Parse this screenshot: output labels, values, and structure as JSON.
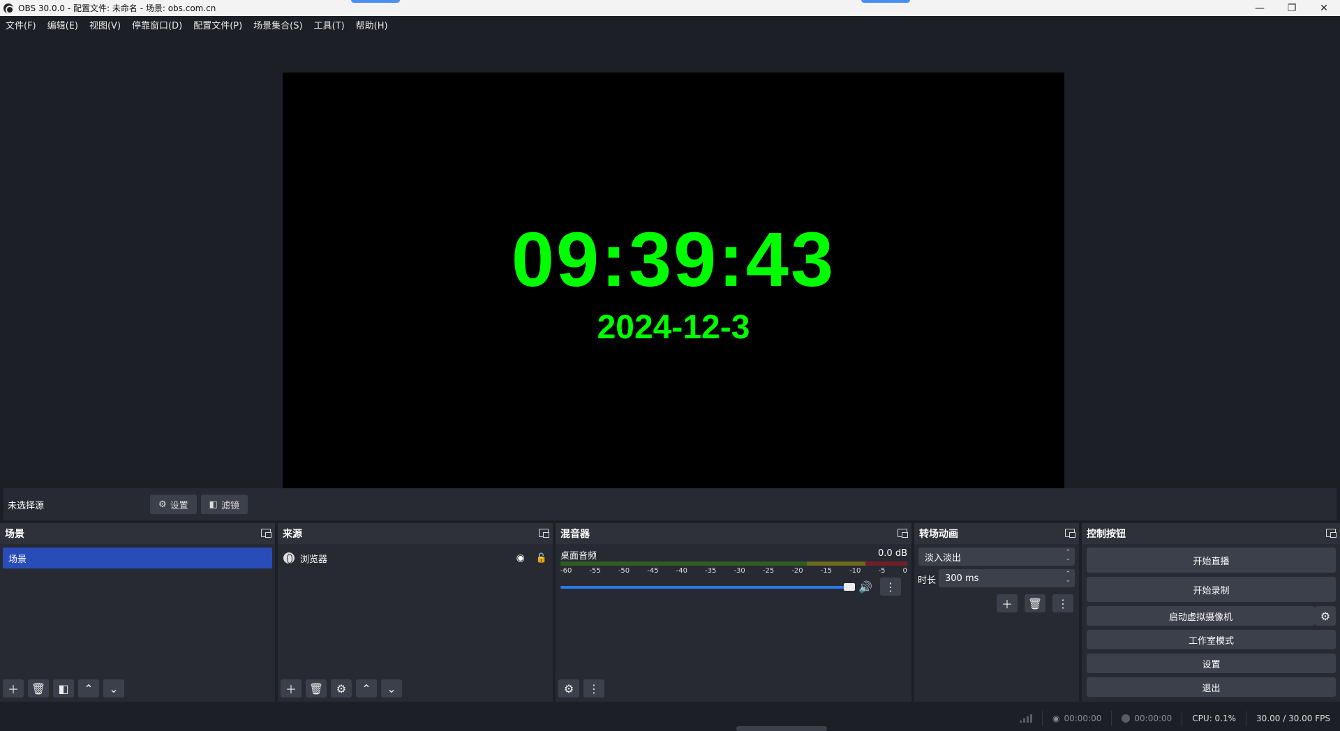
{
  "window": {
    "title": "OBS 30.0.0 - 配置文件: 未命名 - 场景: obs.com.cn",
    "controls": [
      "—",
      "❐",
      "✕"
    ]
  },
  "menu": [
    "文件(F)",
    "编辑(E)",
    "视图(V)",
    "停靠窗口(D)",
    "配置文件(P)",
    "场景集合(S)",
    "工具(T)",
    "帮助(H)"
  ],
  "preview": {
    "time": "09:39:43",
    "date": "2024-12-3",
    "text_color": "#00ff00"
  },
  "source_toolbar": {
    "no_selection": "未选择源",
    "settings": "设置",
    "filters": "滤镜"
  },
  "docks": {
    "scenes": {
      "title": "场景",
      "items": [
        "场景"
      ]
    },
    "sources": {
      "title": "来源",
      "items": [
        "浏览器"
      ]
    },
    "mixer": {
      "title": "混音器",
      "channel": "桌面音频",
      "level": "0.0 dB",
      "ticks": [
        "-60",
        "-55",
        "-50",
        "-45",
        "-40",
        "-35",
        "-30",
        "-25",
        "-20",
        "-15",
        "-10",
        "-5",
        "0"
      ],
      "volume_fraction": 1.0
    },
    "transitions": {
      "title": "转场动画",
      "transition": "淡入淡出",
      "duration_label": "时长",
      "duration": "300 ms"
    },
    "controls": {
      "title": "控制按钮",
      "start_stream": "开始直播",
      "start_record": "开始录制",
      "virtual_cam": "启动虚拟摄像机",
      "studio_mode": "工作室模式",
      "settings": "设置",
      "exit": "退出"
    }
  },
  "status": {
    "stream_time": "00:00:00",
    "record_time": "00:00:00",
    "cpu": "CPU: 0.1%",
    "fps": "30.00 / 30.00 FPS"
  },
  "colors": {
    "selected": "#284cb8",
    "background": "#1d1f26",
    "panel": "#272a33"
  }
}
